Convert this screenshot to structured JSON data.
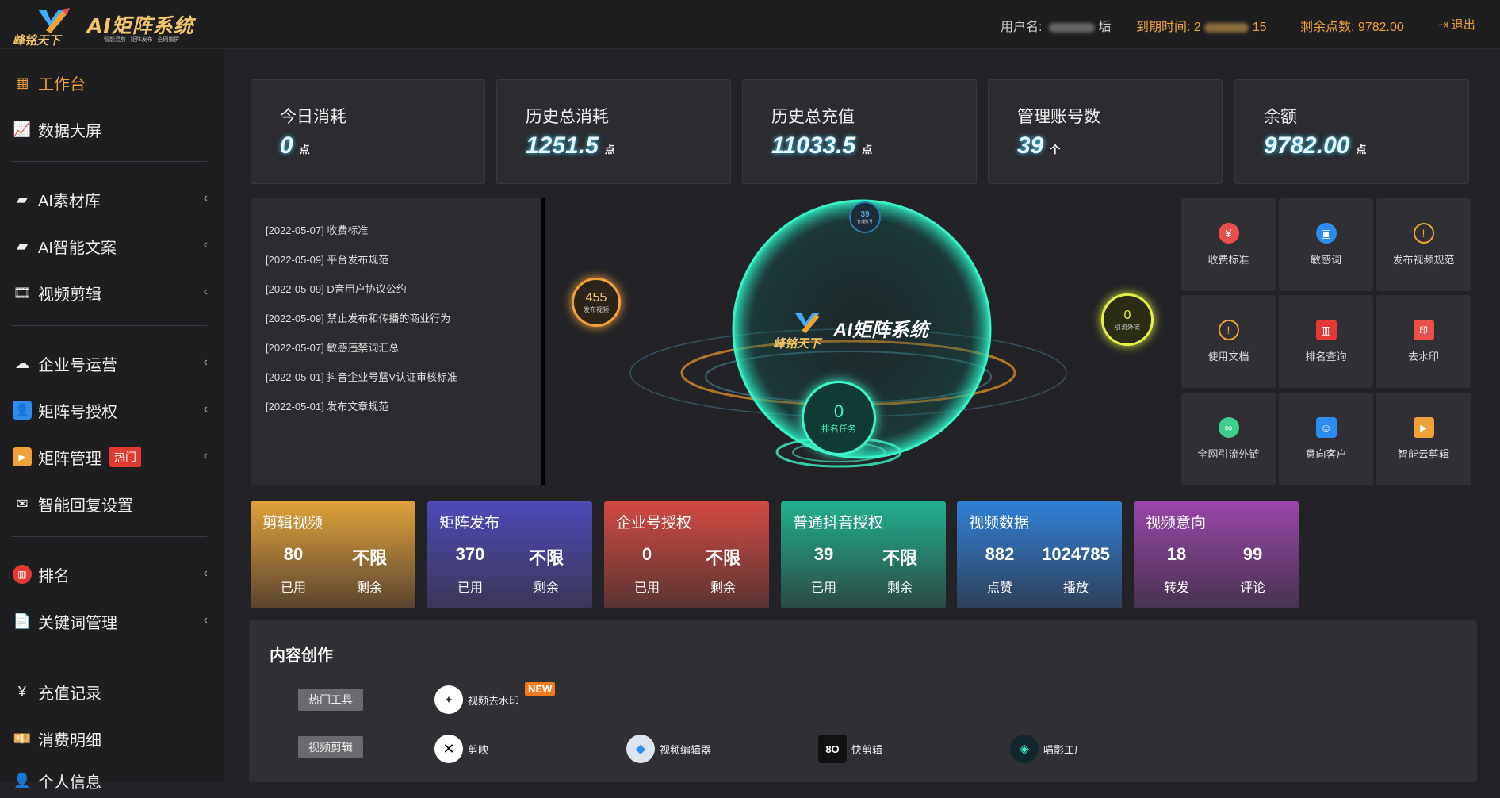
{
  "header": {
    "logo_title": "AI矩阵系统",
    "logo_brand": "峰铭天下",
    "logo_slogan": "— 智能混剪 | 矩阵发布 | 全网霸屏 —",
    "user_label": "用户名:",
    "user_suffix": "垢",
    "expire_label": "到期时间:",
    "expire_prefix": "2",
    "expire_suffix": "15",
    "points_label": "剩余点数:",
    "points_value": "9782.00",
    "logout": "退出"
  },
  "sidebar": {
    "items": [
      {
        "label": "工作台",
        "icon": "grid-icon"
      },
      {
        "label": "数据大屏",
        "icon": "chart-icon"
      },
      {
        "label": "AI素材库",
        "icon": "folder-icon"
      },
      {
        "label": "AI智能文案",
        "icon": "folder-icon"
      },
      {
        "label": "视频剪辑",
        "icon": "film-icon"
      },
      {
        "label": "企业号运营",
        "icon": "cloud-icon"
      },
      {
        "label": "矩阵号授权",
        "icon": "user-icon"
      },
      {
        "label": "矩阵管理",
        "icon": "play-icon",
        "badge": "热门"
      },
      {
        "label": "智能回复设置",
        "icon": "mail-icon"
      },
      {
        "label": "排名",
        "icon": "rank-icon"
      },
      {
        "label": "关键词管理",
        "icon": "file-icon"
      },
      {
        "label": "充值记录",
        "icon": "yen-icon"
      },
      {
        "label": "消费明细",
        "icon": "money-icon"
      },
      {
        "label": "个人信息",
        "icon": "person-icon"
      }
    ]
  },
  "stats": [
    {
      "label": "今日消耗",
      "value": "0",
      "unit": "点"
    },
    {
      "label": "历史总消耗",
      "value": "1251.5",
      "unit": "点"
    },
    {
      "label": "历史总充值",
      "value": "11033.5",
      "unit": "点"
    },
    {
      "label": "管理账号数",
      "value": "39",
      "unit": "个"
    },
    {
      "label": "余额",
      "value": "9782.00",
      "unit": "点"
    }
  ],
  "notices": [
    {
      "date": "[2022-05-07]",
      "title": "收费标准"
    },
    {
      "date": "[2022-05-09]",
      "title": "平台发布规范"
    },
    {
      "date": "[2022-05-09]",
      "title": "D音用户协议公约"
    },
    {
      "date": "[2022-05-09]",
      "title": "禁止发布和传播的商业行为"
    },
    {
      "date": "[2022-05-07]",
      "title": "敏感违禁词汇总"
    },
    {
      "date": "[2022-05-01]",
      "title": "抖音企业号蓝V认证审核标准"
    },
    {
      "date": "[2022-05-01]",
      "title": "发布文章规范"
    }
  ],
  "orbs": {
    "video": {
      "value": "455",
      "label": "发布视频"
    },
    "top": {
      "value": "39",
      "label": "管理账号"
    },
    "traffic": {
      "value": "0",
      "label": "引流外链"
    },
    "rank": {
      "value": "0",
      "label": "排名任务"
    }
  },
  "quick": [
    {
      "label": "收费标准",
      "icon": "yen-badge-icon",
      "color": "#e9504a"
    },
    {
      "label": "敏感词",
      "icon": "briefcase-icon",
      "color": "#2d8cf0"
    },
    {
      "label": "发布视频规范",
      "icon": "alert-icon",
      "color": "#f0a23a"
    },
    {
      "label": "使用文档",
      "icon": "alert-icon",
      "color": "#f0a23a"
    },
    {
      "label": "排名查询",
      "icon": "bar-chart-icon",
      "color": "#e53935"
    },
    {
      "label": "去水印",
      "icon": "stamp-icon",
      "color": "#e9504a"
    },
    {
      "label": "全网引流外链",
      "icon": "link-icon",
      "color": "#3ecf8e"
    },
    {
      "label": "意向客户",
      "icon": "contact-icon",
      "color": "#2d8cf0"
    },
    {
      "label": "智能云剪辑",
      "icon": "video-icon",
      "color": "#f0a23a"
    }
  ],
  "cards": [
    {
      "title": "剪辑视频",
      "v1": "80",
      "l1": "已用",
      "v2": "不限",
      "l2": "剩余",
      "color": "#c78a2c"
    },
    {
      "title": "矩阵发布",
      "v1": "370",
      "l1": "已用",
      "v2": "不限",
      "l2": "剩余",
      "color": "#4b46a8"
    },
    {
      "title": "企业号授权",
      "v1": "0",
      "l1": "已用",
      "v2": "不限",
      "l2": "剩余",
      "color": "#b8423d"
    },
    {
      "title": "普通抖音授权",
      "v1": "39",
      "l1": "已用",
      "v2": "不限",
      "l2": "剩余",
      "color": "#1e9c80"
    },
    {
      "title": "视频数据",
      "v1": "882",
      "l1": "点赞",
      "v2": "1024785",
      "l2": "播放",
      "color": "#2e73c4"
    },
    {
      "title": "视频意向",
      "v1": "18",
      "l1": "转发",
      "v2": "99",
      "l2": "评论",
      "color": "#8a3c9c"
    }
  ],
  "content": {
    "title": "内容创作",
    "tag_hot": "热门工具",
    "tag_edit": "视频剪辑",
    "new_badge": "NEW",
    "tools": [
      {
        "label": "视频去水印",
        "icon": "dewatermark-icon"
      },
      {
        "label": "剪映",
        "icon": "capcut-icon"
      },
      {
        "label": "视频编辑器",
        "icon": "editor-icon"
      },
      {
        "label": "快剪辑",
        "icon": "kuaijianji-icon"
      },
      {
        "label": "喵影工厂",
        "icon": "filmora-icon"
      }
    ]
  }
}
